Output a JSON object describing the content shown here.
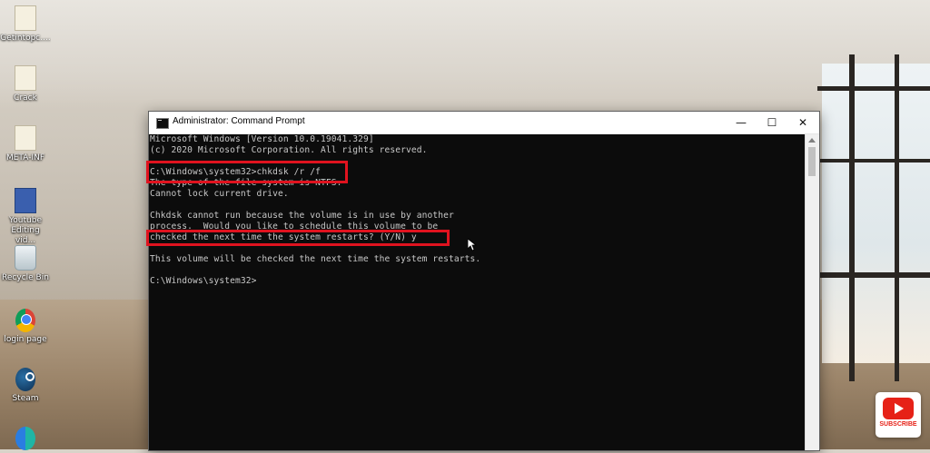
{
  "desktop": {
    "icons": [
      {
        "label": "Getintopc....",
        "icon": "folder-icon"
      },
      {
        "label": "Crack",
        "icon": "folder-icon"
      },
      {
        "label": "META-INF",
        "icon": "file-icon"
      },
      {
        "label": "Youtube Editing vid...",
        "icon": "video-file-icon"
      },
      {
        "label": "Recycle Bin",
        "icon": "recycle-bin-icon"
      },
      {
        "label": "login page",
        "icon": "chrome-icon"
      },
      {
        "label": "Steam",
        "icon": "steam-icon"
      },
      {
        "label": "",
        "icon": "edge-icon"
      }
    ]
  },
  "window": {
    "title": "Administrator: Command Prompt",
    "minimize": "—",
    "maximize": "☐",
    "close": "✕"
  },
  "terminal": {
    "lines": [
      "Microsoft Windows [Version 10.0.19041.329]",
      "(c) 2020 Microsoft Corporation. All rights reserved.",
      "",
      "C:\\Windows\\system32>chkdsk /r /f",
      "The type of the file system is NTFS.",
      "Cannot lock current drive.",
      "",
      "Chkdsk cannot run because the volume is in use by another",
      "process.  Would you like to schedule this volume to be",
      "checked the next time the system restarts? (Y/N) y",
      "",
      "This volume will be checked the next time the system restarts.",
      "",
      "C:\\Windows\\system32>"
    ]
  },
  "overlay": {
    "subscribe_label": "SUBSCRIBE",
    "highlight_color": "#e0131f"
  },
  "colors": {
    "terminal_bg": "#0c0c0c",
    "terminal_fg": "#c8c8c8",
    "titlebar_bg": "#ffffff"
  }
}
